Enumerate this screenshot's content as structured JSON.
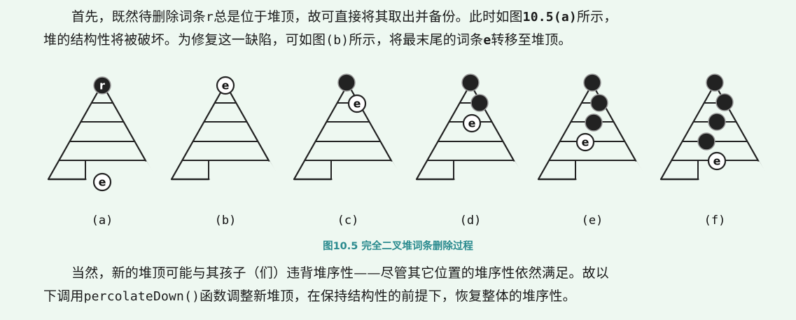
{
  "paragraph_top": {
    "line1": [
      "首先，既然待删除词条",
      "r",
      "总是位于堆顶，故可直接将其取出并备份。此时如图",
      "10.5(a)",
      "所示，"
    ],
    "line2": [
      "堆的结构性将被破坏。为修复这一缺陷，可如图",
      "(b)",
      "所示，将最末尾的词条",
      "e",
      "转移至堆顶。"
    ]
  },
  "figure": {
    "caption": "图10.5  完全二叉堆词条删除过程",
    "colors": {
      "tree_line": "#222222",
      "dark_node": "#222222",
      "caption": "#2a8a8e"
    },
    "panels": [
      {
        "label": "(a)",
        "top_node": "r",
        "bottom_node": "e",
        "dark_nodes": 0
      },
      {
        "label": "(b)",
        "top_node": "e",
        "dark_nodes": 0
      },
      {
        "label": "(c)",
        "node": "e",
        "dark_nodes": 1
      },
      {
        "label": "(d)",
        "node": "e",
        "dark_nodes": 2
      },
      {
        "label": "(e)",
        "node": "e",
        "dark_nodes": 3
      },
      {
        "label": "(f)",
        "node": "e",
        "dark_nodes": 4
      }
    ]
  },
  "paragraph_bottom": {
    "line1": "当然，新的堆顶可能与其孩子（们）违背堆序性——尽管其它位置的堆序性依然满足。故以",
    "line2": [
      "下调用",
      "percolateDown()",
      "函数调整新堆顶，在保持结构性的前提下，恢复整体的堆序性。"
    ]
  }
}
